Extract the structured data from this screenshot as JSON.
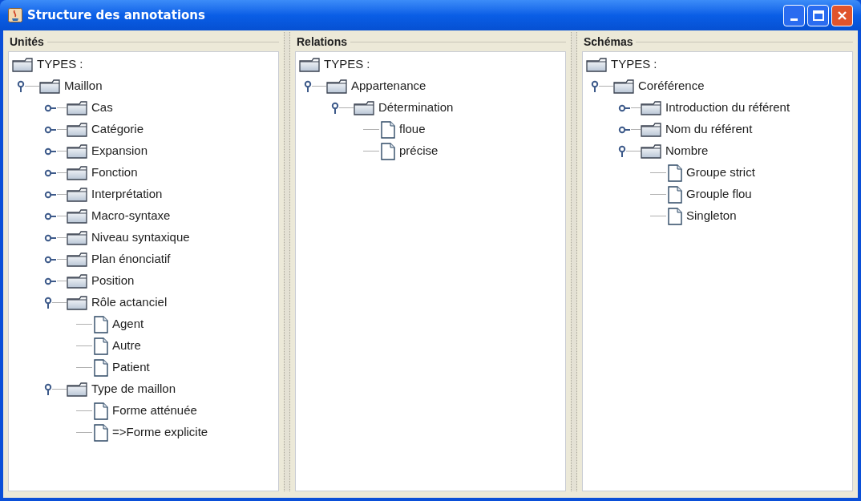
{
  "window": {
    "title": "Structure des annotations"
  },
  "panels": [
    {
      "title": "Unités",
      "tree": {
        "label": "TYPES :",
        "kind": "folder",
        "children": [
          {
            "label": "Maillon",
            "kind": "folder",
            "expanded": true,
            "children": [
              {
                "label": "Cas",
                "kind": "folder",
                "expanded": false
              },
              {
                "label": "Catégorie",
                "kind": "folder",
                "expanded": false
              },
              {
                "label": "Expansion",
                "kind": "folder",
                "expanded": false
              },
              {
                "label": "Fonction",
                "kind": "folder",
                "expanded": false
              },
              {
                "label": "Interprétation",
                "kind": "folder",
                "expanded": false
              },
              {
                "label": "Macro-syntaxe",
                "kind": "folder",
                "expanded": false
              },
              {
                "label": "Niveau syntaxique",
                "kind": "folder",
                "expanded": false
              },
              {
                "label": "Plan énonciatif",
                "kind": "folder",
                "expanded": false
              },
              {
                "label": "Position",
                "kind": "folder",
                "expanded": false
              },
              {
                "label": "Rôle actanciel",
                "kind": "folder",
                "expanded": true,
                "children": [
                  {
                    "label": "Agent",
                    "kind": "leaf"
                  },
                  {
                    "label": "Autre",
                    "kind": "leaf"
                  },
                  {
                    "label": "Patient",
                    "kind": "leaf"
                  }
                ]
              },
              {
                "label": "Type de maillon",
                "kind": "folder",
                "expanded": true,
                "children": [
                  {
                    "label": "Forme atténuée",
                    "kind": "leaf"
                  },
                  {
                    "label": "=>Forme explicite",
                    "kind": "leaf"
                  }
                ]
              }
            ]
          }
        ]
      }
    },
    {
      "title": "Relations",
      "tree": {
        "label": "TYPES :",
        "kind": "folder",
        "children": [
          {
            "label": "Appartenance",
            "kind": "folder",
            "expanded": true,
            "children": [
              {
                "label": "Détermination",
                "kind": "folder",
                "expanded": true,
                "children": [
                  {
                    "label": "floue",
                    "kind": "leaf"
                  },
                  {
                    "label": "précise",
                    "kind": "leaf"
                  }
                ]
              }
            ]
          }
        ]
      }
    },
    {
      "title": "Schémas",
      "tree": {
        "label": "TYPES :",
        "kind": "folder",
        "children": [
          {
            "label": "Coréférence",
            "kind": "folder",
            "expanded": true,
            "children": [
              {
                "label": "Introduction du référent",
                "kind": "folder",
                "expanded": false
              },
              {
                "label": "Nom du référent",
                "kind": "folder",
                "expanded": false
              },
              {
                "label": "Nombre",
                "kind": "folder",
                "expanded": true,
                "children": [
                  {
                    "label": "Groupe strict",
                    "kind": "leaf"
                  },
                  {
                    "label": "Grouple flou",
                    "kind": "leaf"
                  },
                  {
                    "label": "Singleton",
                    "kind": "leaf"
                  }
                ]
              }
            ]
          }
        ]
      }
    }
  ]
}
